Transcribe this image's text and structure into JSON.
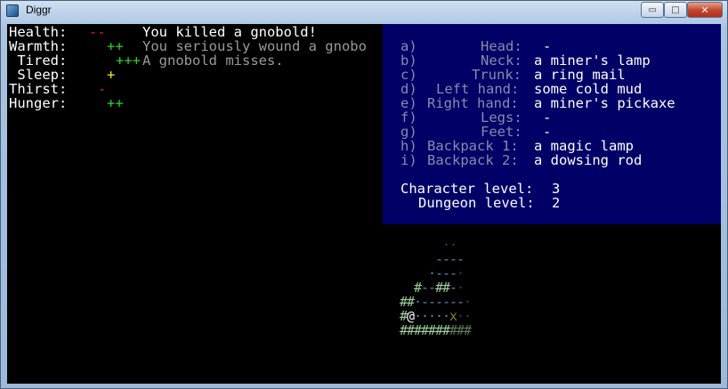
{
  "window": {
    "title": "Diggr"
  },
  "controls": {
    "minimize": "▭",
    "maximize": "□",
    "close": "✕"
  },
  "stats": [
    {
      "label": "Health:",
      "bar": "--",
      "color": "red"
    },
    {
      "label": "Warmth:",
      "bar": "++",
      "color": "green"
    },
    {
      "label": " Tired:",
      "bar": "+++",
      "color": "green"
    },
    {
      "label": " Sleep:",
      "bar": "+",
      "color": "yellow"
    },
    {
      "label": "Thirst:",
      "bar": "-",
      "color": "red"
    },
    {
      "label": "Hunger:",
      "bar": "++",
      "color": "green"
    }
  ],
  "messages": [
    {
      "text": "You killed a gnobold!",
      "state": "new"
    },
    {
      "text": "You seriously wound a gnobo",
      "state": "old"
    },
    {
      "text": "A gnobold misses.",
      "state": "old"
    }
  ],
  "inventory": {
    "slots": [
      {
        "key": "a)",
        "slot": "Head:",
        "item": "-"
      },
      {
        "key": "b)",
        "slot": "Neck:",
        "item": "a miner's lamp"
      },
      {
        "key": "c)",
        "slot": "Trunk:",
        "item": "a ring mail"
      },
      {
        "key": "d)",
        "slot": "Left hand:",
        "item": "some cold mud"
      },
      {
        "key": "e)",
        "slot": "Right hand:",
        "item": "a miner's pickaxe"
      },
      {
        "key": "f)",
        "slot": "Legs:",
        "item": "-"
      },
      {
        "key": "g)",
        "slot": "Feet:",
        "item": "-"
      },
      {
        "key": "h)",
        "slot": "Backpack 1:",
        "item": "a magic lamp"
      },
      {
        "key": "i)",
        "slot": "Backpack 2:",
        "item": "a dowsing rod"
      }
    ],
    "character_level_label": "Character level:",
    "character_level": "3",
    "dungeon_level_label": "Dungeon level:",
    "dungeon_level": "2"
  },
  "map": {
    "rows": [
      "      ..  ",
      "     ____ ",
      "    .___. ",
      "  #--##-. ",
      "##.------.",
      "#@.....x..",
      "##########"
    ],
    "player_glyph": "@",
    "colors": {
      "wall": "#9fd09f",
      "wall_dim": "#5e7e5e",
      "floor": "#6a7fb0",
      "floor_dim": "#2c3c66",
      "player": "#ffffff",
      "item": "#8a7a3a"
    }
  }
}
